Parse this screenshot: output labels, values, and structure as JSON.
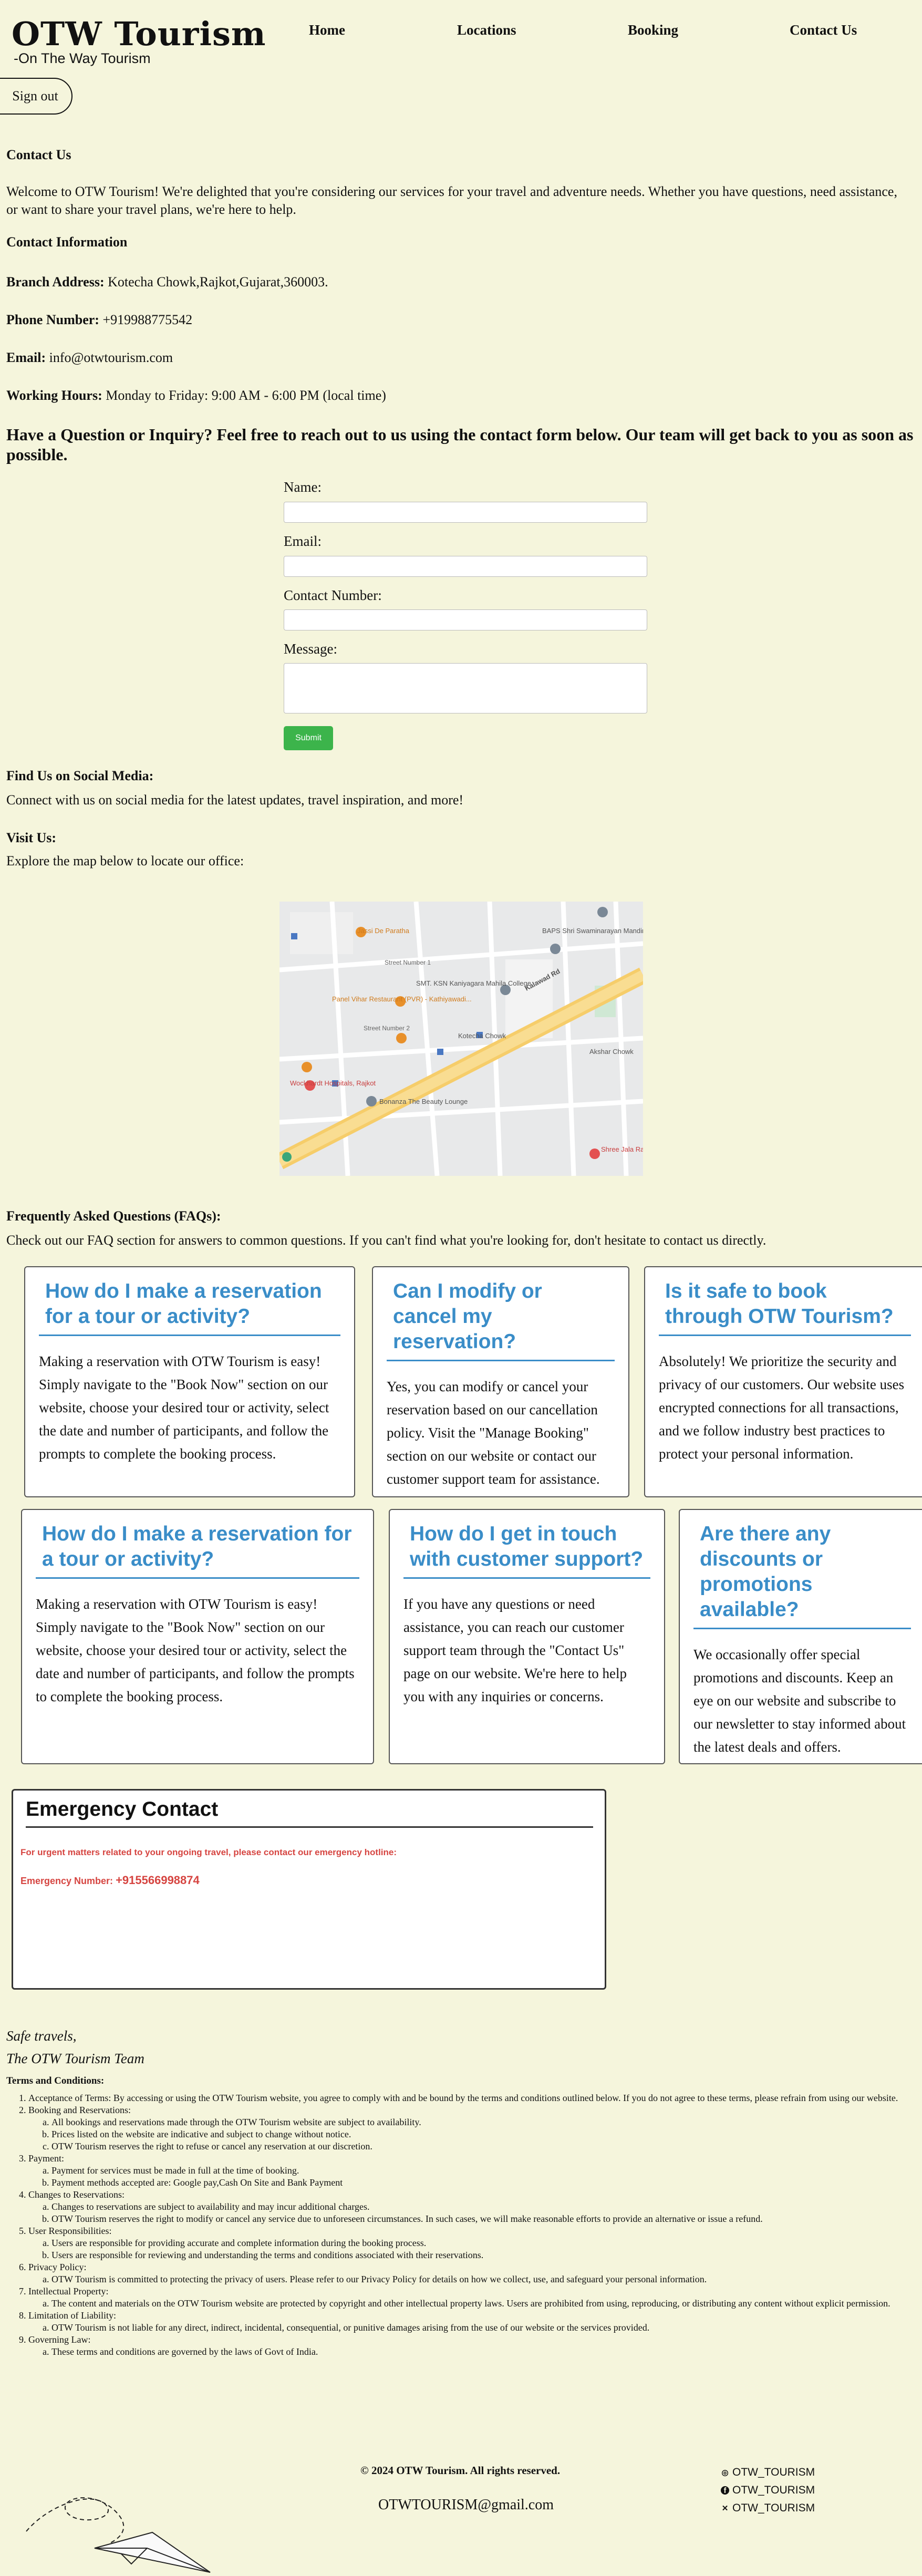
{
  "header": {
    "brand": "OTW Tourism",
    "tagline": "-On The Way Tourism",
    "nav": [
      "Home",
      "Locations",
      "Booking",
      "Contact Us"
    ],
    "signout": "Sign out"
  },
  "contact": {
    "heading": "Contact Us",
    "welcome": "Welcome to OTW Tourism! We're delighted that you're considering our services for your travel and adventure needs. Whether you have questions, need assistance, or want to share your travel plans, we're here to help.",
    "info_heading": "Contact Information",
    "branch_label": "Branch Address:",
    "branch_value": "Kotecha Chowk,Rajkot,Gujarat,360003.",
    "phone_label": "Phone Number:",
    "phone_value": "+919988775542",
    "email_label": "Email:",
    "email_value": "info@otwtourism.com",
    "hours_label": "Working Hours:",
    "hours_value": "Monday to Friday: 9:00 AM - 6:00 PM (local time)"
  },
  "form": {
    "heading": "Have a Question or Inquiry? Feel free to reach out to us using the contact form below. Our team will get back to you as soon as possible.",
    "name_label": "Name:",
    "email_label": "Email:",
    "contact_label": "Contact Number:",
    "message_label": "Message:",
    "submit": "Submit"
  },
  "social": {
    "heading": "Find Us on Social Media:",
    "text": "Connect with us on social media for the latest updates, travel inspiration, and more!"
  },
  "visit": {
    "heading": "Visit Us:",
    "text": "Explore the map below to locate our office:"
  },
  "map_labels": {
    "jassi": "Jassi De Paratha",
    "baps": "BAPS Shri Swaminarayan Mandir, Rajkot",
    "smt": "SMT. KSN Kaniyagara Mahila College",
    "panel": "Panel Vihar Restaurant (PVR) - Kathiyawadi...",
    "kotecha": "Kotecha Chowk",
    "road": "Kalawad Rd",
    "bonanza": "Bonanza The Beauty Lounge",
    "wockhardt": "Wockhardt Hospitals, Rajkot",
    "akshar": "Akshar Chowk",
    "shree": "Shree Jala Raghukul",
    "street1": "Street Number 1",
    "street2": "Street Number 2"
  },
  "faq": {
    "heading": "Frequently Asked Questions (FAQs):",
    "intro": "Check out our FAQ section for answers to common questions. If you can't find what you're looking for, don't hesitate to contact us directly.",
    "items": [
      {
        "q": "How do I make a reservation for a tour or activity?",
        "a": "Making a reservation with OTW Tourism is easy! Simply navigate to the \"Book Now\" section on our website, choose your desired tour or activity, select the date and number of participants, and follow the prompts to complete the booking process."
      },
      {
        "q": "Can I modify or cancel my reservation?",
        "a": "Yes, you can modify or cancel your reservation based on our cancellation policy. Visit the \"Manage Booking\" section on our website or contact our customer support team for assistance."
      },
      {
        "q": "Is it safe to book through OTW Tourism?",
        "a": "Absolutely! We prioritize the security and privacy of our customers. Our website uses encrypted connections for all transactions, and we follow industry best practices to protect your personal information."
      },
      {
        "q": "How do I make a reservation for a tour or activity?",
        "a": "Making a reservation with OTW Tourism is easy! Simply navigate to the \"Book Now\" section on our website, choose your desired tour or activity, select the date and number of participants, and follow the prompts to complete the booking process."
      },
      {
        "q": "How do I get in touch with customer support?",
        "a": "If you have any questions or need assistance, you can reach our customer support team through the \"Contact Us\" page on our website. We're here to help you with any inquiries or concerns."
      },
      {
        "q": "Are there any discounts or promotions available?",
        "a": "We occasionally offer special promotions and discounts. Keep an eye on our website and subscribe to our newsletter to stay informed about the latest deals and offers."
      }
    ]
  },
  "emergency": {
    "heading": "Emergency Contact",
    "message": "For urgent matters related to your ongoing travel, please contact our emergency hotline:",
    "label": "Emergency Number:",
    "number": "+915566998874"
  },
  "signoff": {
    "line1": "Safe travels,",
    "line2": "The OTW Tourism Team"
  },
  "terms": {
    "heading": "Terms and Conditions:",
    "items": [
      {
        "text": "Acceptance of Terms: By accessing or using the OTW Tourism website, you agree to comply with and be bound by the terms and conditions outlined below. If you do not agree to these terms, please refrain from using our website.",
        "sub": []
      },
      {
        "text": "Booking and Reservations:",
        "sub": [
          "All bookings and reservations made through the OTW Tourism website are subject to availability.",
          "Prices listed on the website are indicative and subject to change without notice.",
          "OTW Tourism reserves the right to refuse or cancel any reservation at our discretion."
        ]
      },
      {
        "text": "Payment:",
        "sub": [
          "Payment for services must be made in full at the time of booking.",
          "Payment methods accepted are: Google pay,Cash On Site and Bank Payment"
        ]
      },
      {
        "text": "Changes to Reservations:",
        "sub": [
          "Changes to reservations are subject to availability and may incur additional charges.",
          "OTW Tourism reserves the right to modify or cancel any service due to unforeseen circumstances. In such cases, we will make reasonable efforts to provide an alternative or issue a refund."
        ]
      },
      {
        "text": "User Responsibilities:",
        "sub": [
          "Users are responsible for providing accurate and complete information during the booking process.",
          "Users are responsible for reviewing and understanding the terms and conditions associated with their reservations."
        ]
      },
      {
        "text": "Privacy Policy:",
        "sub": [
          "OTW Tourism is committed to protecting the privacy of users. Please refer to our Privacy Policy for details on how we collect, use, and safeguard your personal information."
        ]
      },
      {
        "text": "Intellectual Property:",
        "sub": [
          "The content and materials on the OTW Tourism website are protected by copyright and other intellectual property laws. Users are prohibited from using, reproducing, or distributing any content without explicit permission."
        ]
      },
      {
        "text": "Limitation of Liability:",
        "sub": [
          "OTW Tourism is not liable for any direct, indirect, incidental, consequential, or punitive damages arising from the use of our website or the services provided."
        ]
      },
      {
        "text": "Governing Law:",
        "sub": [
          "These terms and conditions are governed by the laws of Govt of India."
        ]
      }
    ]
  },
  "footer": {
    "copyright": "© 2024 OTW Tourism. All rights reserved.",
    "email": "OTWTOURISM@gmail.com",
    "social": [
      {
        "icon": "instagram-icon",
        "glyph": "◎",
        "label": "OTW_TOURISM"
      },
      {
        "icon": "facebook-icon",
        "glyph": "f",
        "label": "OTW_TOURISM"
      },
      {
        "icon": "x-icon",
        "glyph": "✕",
        "label": "OTW_TOURISM"
      }
    ]
  }
}
